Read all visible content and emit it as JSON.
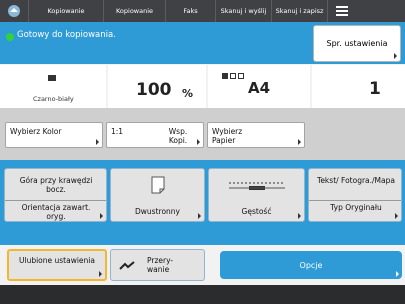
{
  "topbar": {
    "tabs": [
      "Kopiowanie",
      "Kopiowanie",
      "Faks",
      "Skanuj i wyślij",
      "Skanuj i zapisz"
    ]
  },
  "status": {
    "text": "Gotowy do kopiowania.",
    "settings_button": "Spr. ustawienia"
  },
  "summary": {
    "color_mode": "Czarno-biały",
    "zoom_value": "100",
    "zoom_unit": "%",
    "paper_size": "A4",
    "copies": "1"
  },
  "row_buttons": {
    "select_color": "Wybierz Kolor",
    "ratio_value": "1:1",
    "ratio_label": "Wsp. Kopi.",
    "select_paper": "Wybierz Papier"
  },
  "functions": {
    "top_left": "Góra przy krawędzi bocz.",
    "orientation": "Orientacja zawart. oryg.",
    "duplex": "Dwustronny",
    "density": "Gęstość",
    "text_photo": "Tekst/ Fotogra./Mapa",
    "original_type": "Typ Oryginału"
  },
  "bottom_row": {
    "favorites": "Ulubione ustawienia",
    "interrupt": "Przery- wanie",
    "options": "Opcje"
  },
  "colors": {
    "accent": "#2f9bd6",
    "topbar": "#3f4145",
    "highlight": "#f2b62f"
  }
}
